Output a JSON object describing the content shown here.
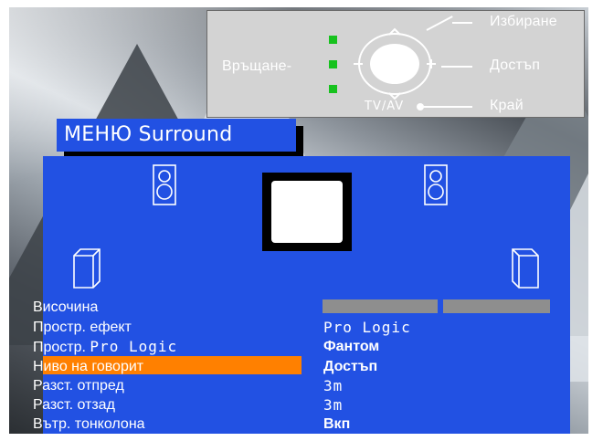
{
  "help": {
    "select": "Избиране",
    "back": "Връщане-",
    "access": "Достъп",
    "tvav": "TV/AV",
    "exit": "Край"
  },
  "menu": {
    "title": "МЕНЮ Surround",
    "rows": [
      {
        "label": "Височина",
        "value": ""
      },
      {
        "label": "Простр. ефект",
        "value": "Pro Logic"
      },
      {
        "label": "Простр. Pro Logic",
        "value": "Фантом"
      },
      {
        "label": "Ниво на говорит",
        "value": "Достъп"
      },
      {
        "label": "Разст. отпред",
        "value": "3m"
      },
      {
        "label": "Разст. отзад",
        "value": "3m"
      },
      {
        "label": "Вътр. тонколона",
        "value": "Вкп"
      }
    ],
    "selected_index": 3,
    "height_bar_fill": 1.0
  },
  "colors": {
    "panel": "#2251e3",
    "highlight": "#ff8000",
    "led": "#17c21e",
    "help_bg": "#d3d3d3"
  }
}
